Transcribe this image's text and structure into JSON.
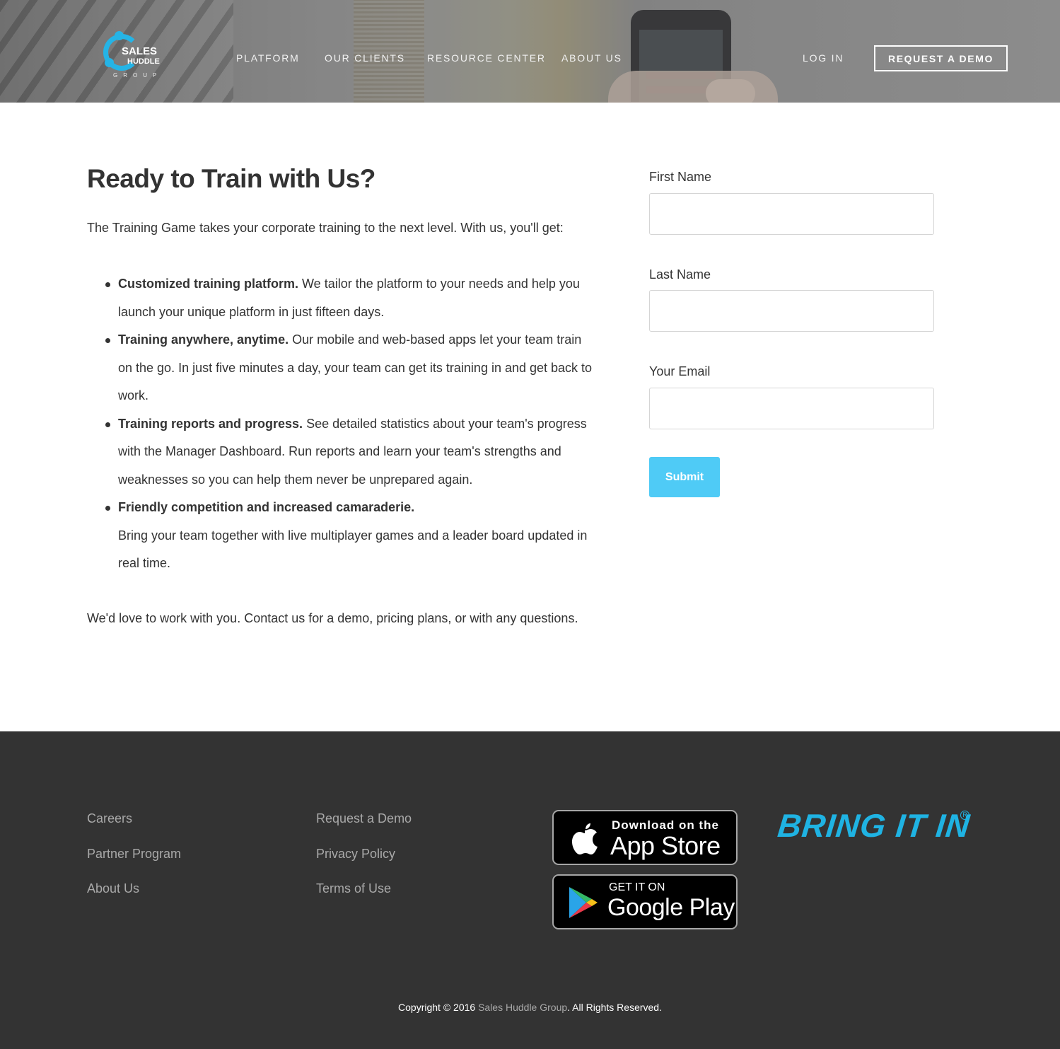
{
  "brand": {
    "logo_top": "SALES",
    "logo_mid": "HUDDLE",
    "logo_sub": "GROUP",
    "accent_color": "#25b4e6"
  },
  "nav": {
    "items": [
      "PLATFORM",
      "OUR CLIENTS",
      "RESOURCE CENTER",
      "ABOUT US"
    ],
    "login": "LOG IN",
    "demo": "REQUEST A DEMO"
  },
  "main": {
    "title": "Ready to Train with Us?",
    "intro": "The Training Game takes your corporate training to the next level. With us, you'll get:",
    "features": [
      {
        "bold": "Customized training platform.",
        "lines": [
          " We tailor the platform to your needs and help you",
          "launch your unique platform in just fifteen days."
        ]
      },
      {
        "bold": "Training anywhere, anytime.",
        "lines": [
          " Our mobile and web-based apps let your team train",
          "on the go. In just five minutes a day, your team can get its training in and get back to",
          "work."
        ]
      },
      {
        "bold": "Training reports and progress.",
        "lines": [
          " See detailed statistics about your team's progress",
          "with the Manager Dashboard. Run reports and learn your team's strengths and",
          "weaknesses so you can help them never be unprepared again."
        ]
      },
      {
        "bold": "Friendly competition and increased camaraderie.",
        "lines": [
          "",
          "Bring your team together with live multiplayer games and a leader board updated in",
          "real time."
        ]
      }
    ],
    "outro": "We'd love to work with you. Contact us for a demo, pricing plans, or with any questions."
  },
  "form": {
    "first_name_label": "First Name",
    "first_name_value": "",
    "last_name_label": "Last Name",
    "last_name_value": "",
    "email_label": "Your Email",
    "email_value": "",
    "submit": "Submit",
    "submit_color": "#4fcbf6"
  },
  "footer": {
    "col1": [
      "Careers",
      "Partner Program",
      "About Us"
    ],
    "col2": [
      "Request a Demo",
      "Privacy Policy",
      "Terms of Use"
    ],
    "app_store_small": "Download on the",
    "app_store_big": "App Store",
    "google_small": "GET IT ON",
    "google_big": "Google Play",
    "tagline": "BRING IT IN",
    "tagline_mark": "R",
    "copyright_pre": "Copyright © 2016 ",
    "copyright_company": "Sales Huddle Group",
    "copyright_post": ". All Rights Reserved.",
    "background": "#333333",
    "tagline_color": "#1fb3e3"
  }
}
